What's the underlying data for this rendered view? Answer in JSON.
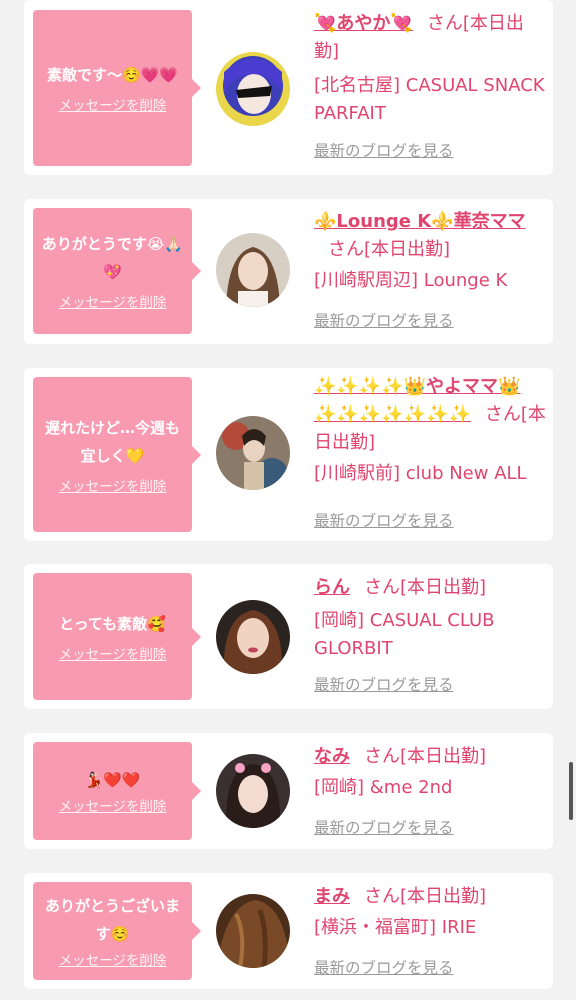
{
  "labels": {
    "delete": "メッセージを削除",
    "blog": "最新のブログを見る"
  },
  "colors": {
    "bubble": "#f89ab0",
    "name": "#e0456f",
    "blog_link": "#9a9a9a",
    "background": "#f2f2f2"
  },
  "messages": [
    {
      "message": "素敵です〜☺️💗💗",
      "cast_name": "💘あやか💘",
      "honorific": "さん[本日出勤]",
      "shop": "[北名古屋] CASUAL SNACK PARFAIT",
      "avatar": "avatar-photo"
    },
    {
      "message": "ありがとうです😭🙏🏻💖",
      "cast_name": "⚜️Lounge K⚜️華奈ママ",
      "honorific": "さん[本日出勤]",
      "shop": "[川崎駅周辺] Lounge K",
      "avatar": "avatar-photo"
    },
    {
      "message": "遅れたけど…今週も宜しく💛",
      "cast_name": "✨✨✨✨👑やよママ👑✨✨✨✨✨✨✨",
      "honorific": "さん[本日出勤]",
      "shop": "[川崎駅前] club New ALL",
      "avatar": "avatar-photo"
    },
    {
      "message": "とっても素敵🥰",
      "cast_name": "らん",
      "honorific": "さん[本日出勤]",
      "shop": "[岡崎] CASUAL CLUB GLORBIT",
      "avatar": "avatar-photo"
    },
    {
      "message": "💃🏻❤️❤️",
      "cast_name": "なみ",
      "honorific": "さん[本日出勤]",
      "shop": "[岡崎] &me 2nd",
      "avatar": "avatar-photo"
    },
    {
      "message": "ありがとうございます☺️",
      "cast_name": "まみ",
      "honorific": "さん[本日出勤]",
      "shop": "[横浜・福富町] IRIE",
      "avatar": "avatar-photo"
    }
  ]
}
